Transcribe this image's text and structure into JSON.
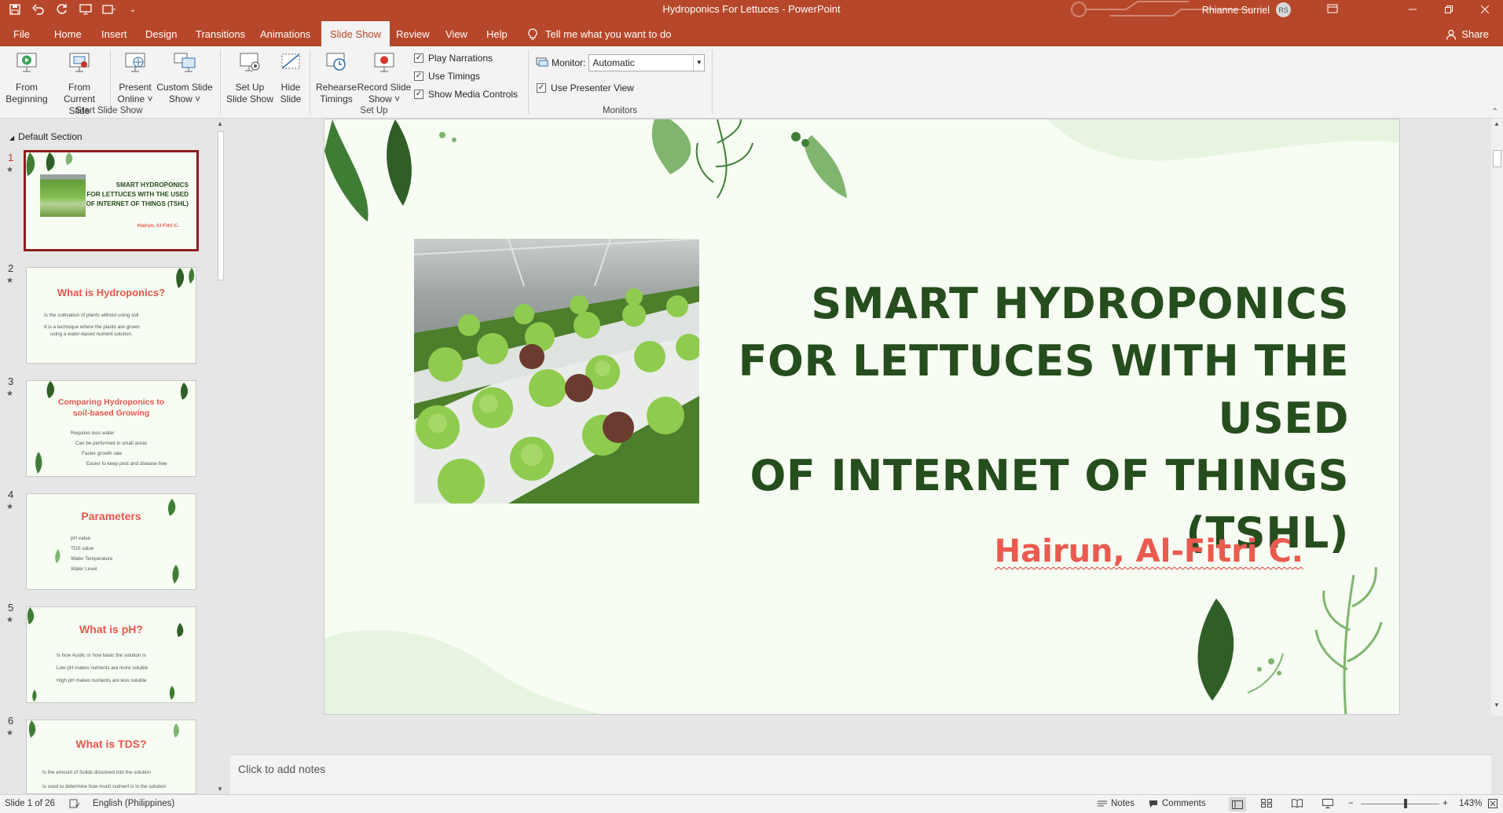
{
  "app": {
    "document_title": "Hydroponics For Lettuces",
    "app_name": "PowerPoint",
    "user_name": "Rhianne Surriel",
    "user_initials": "RS"
  },
  "tabs": [
    "File",
    "Home",
    "Insert",
    "Design",
    "Transitions",
    "Animations",
    "Slide Show",
    "Review",
    "View",
    "Help"
  ],
  "active_tab": "Slide Show",
  "tell_me": "Tell me what you want to do",
  "share": "Share",
  "ribbon": {
    "start_group": {
      "label": "Start Slide Show",
      "from_beginning_1": "From",
      "from_beginning_2": "Beginning",
      "from_current_1": "From",
      "from_current_2": "Current Slide",
      "present_online_1": "Present",
      "present_online_2": "Online ˅",
      "custom_1": "Custom Slide",
      "custom_2": "Show ˅"
    },
    "setup_group": {
      "label": "Set Up",
      "setup_1": "Set Up",
      "setup_2": "Slide Show",
      "hide_1": "Hide",
      "hide_2": "Slide",
      "rehearse_1": "Rehearse",
      "rehearse_2": "Timings",
      "record_1": "Record Slide",
      "record_2": "Show ˅",
      "play_narrations": "Play Narrations",
      "use_timings": "Use Timings",
      "show_media_controls": "Show Media Controls"
    },
    "monitors_group": {
      "label": "Monitors",
      "monitor_label": "Monitor:",
      "monitor_value": "Automatic",
      "use_presenter_view": "Use Presenter View"
    }
  },
  "thumbnails": {
    "section": "Default Section",
    "slides": [
      {
        "num": "1",
        "title_1": "SMART HYDROPONICS",
        "title_2": "FOR LETTUCES WITH THE USED",
        "title_3": "OF INTERNET OF THINGS (TSHL)",
        "author": "Hairun, Al-Fitri C."
      },
      {
        "num": "2",
        "title": "What is Hydroponics?",
        "bullets": [
          "Is the cultivation of plants without using soil",
          "It is a technique where the plants are grown",
          "using a water-based nutrient solution."
        ]
      },
      {
        "num": "3",
        "title_1": "Comparing Hydroponics to",
        "title_2": "soil-based Growing",
        "bullets": [
          "Requires less water",
          "Can be performed in small areas",
          "Faster growth rate",
          "Easier to keep pest and disease-free"
        ]
      },
      {
        "num": "4",
        "title": "Parameters",
        "bullets": [
          "pH value",
          "TDS value",
          "Water Temperature",
          "Water Level"
        ]
      },
      {
        "num": "5",
        "title": "What is pH?",
        "bullets": [
          "Is how Acidic or how basic the solution is",
          "Low pH makes nutrients are more soluble",
          "High pH makes nutrients are less soluble"
        ]
      },
      {
        "num": "6",
        "title": "What is TDS?",
        "bullets": [
          "Is the amount of Solids dissolved into the solution",
          "Is used to determine how much nutrient is in the solution"
        ]
      }
    ]
  },
  "slide": {
    "title_line1": "SMART HYDROPONICS",
    "title_line2": "FOR LETTUCES WITH THE USED",
    "title_line3": "OF INTERNET OF THINGS (TSHL)",
    "author": "Hairun, Al-Fitri C."
  },
  "notes_placeholder": "Click to add notes",
  "status": {
    "slide_count": "Slide 1 of 26",
    "language": "English (Philippines)",
    "notes": "Notes",
    "comments": "Comments",
    "zoom": "143%"
  },
  "colors": {
    "accent": "#b7472a",
    "title_green": "#264d1d",
    "author_red": "#ea5a4f"
  }
}
